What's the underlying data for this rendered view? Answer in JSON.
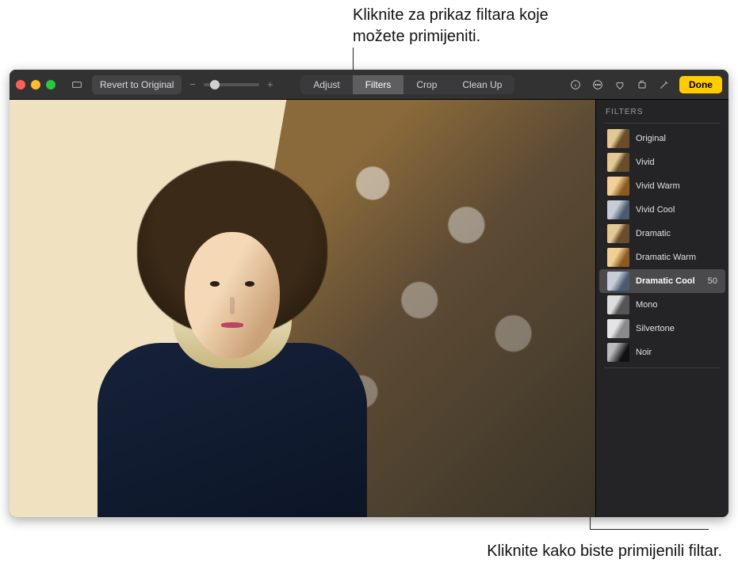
{
  "callouts": {
    "top": "Kliknite za prikaz filtara koje možete primijeniti.",
    "bottom": "Kliknite kako biste primijenili filtar."
  },
  "toolbar": {
    "revert": "Revert to Original",
    "tabs": {
      "adjust": "Adjust",
      "filters": "Filters",
      "crop": "Crop",
      "cleanup": "Clean Up"
    },
    "done": "Done"
  },
  "sidebar": {
    "title": "FILTERS",
    "selected_value": "50",
    "items": [
      {
        "name": "Original",
        "variant": "thumb"
      },
      {
        "name": "Vivid",
        "variant": "thumb"
      },
      {
        "name": "Vivid Warm",
        "variant": "thumb warm"
      },
      {
        "name": "Vivid Cool",
        "variant": "thumb cool"
      },
      {
        "name": "Dramatic",
        "variant": "thumb"
      },
      {
        "name": "Dramatic Warm",
        "variant": "thumb warm"
      },
      {
        "name": "Dramatic Cool",
        "variant": "thumb cool",
        "selected": true,
        "value": "50"
      },
      {
        "name": "Mono",
        "variant": "thumb mono"
      },
      {
        "name": "Silvertone",
        "variant": "thumb silver"
      },
      {
        "name": "Noir",
        "variant": "thumb noir"
      }
    ]
  }
}
